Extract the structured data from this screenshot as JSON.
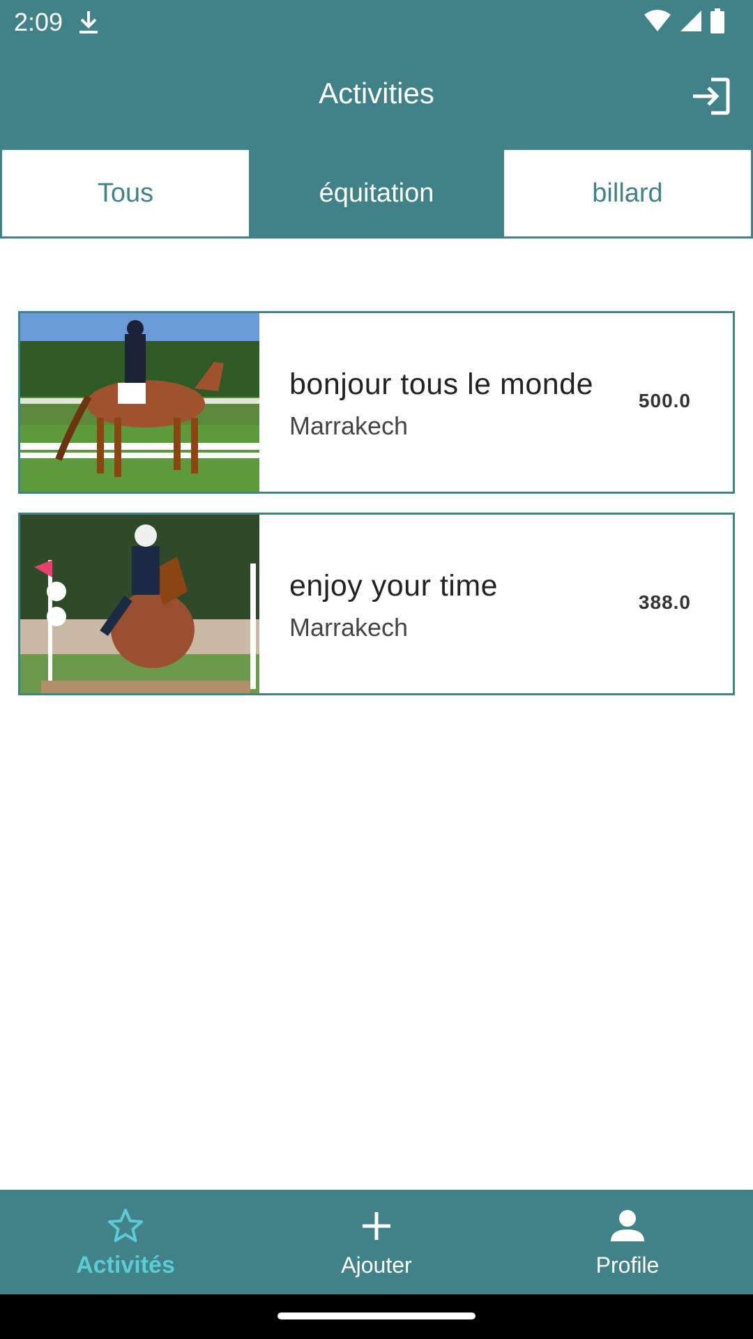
{
  "status_bar": {
    "time": "2:09"
  },
  "app_bar": {
    "title": "Activities"
  },
  "tabs": [
    {
      "label": "Tous",
      "active": false
    },
    {
      "label": "équitation",
      "active": true
    },
    {
      "label": "billard",
      "active": false
    }
  ],
  "activities": [
    {
      "title": "bonjour tous le monde",
      "location": "Marrakech",
      "price": "500.0",
      "image": "dressage-horse-photo"
    },
    {
      "title": "enjoy your time",
      "location": "Marrakech",
      "price": "388.0",
      "image": "jumping-horse-photo"
    }
  ],
  "bottom_nav": [
    {
      "label": "Activités",
      "icon": "star-icon",
      "active": true
    },
    {
      "label": "Ajouter",
      "icon": "plus-icon",
      "active": false
    },
    {
      "label": "Profile",
      "icon": "person-icon",
      "active": false
    }
  ],
  "colors": {
    "primary": "#418288",
    "accent": "#5ccbd6"
  }
}
